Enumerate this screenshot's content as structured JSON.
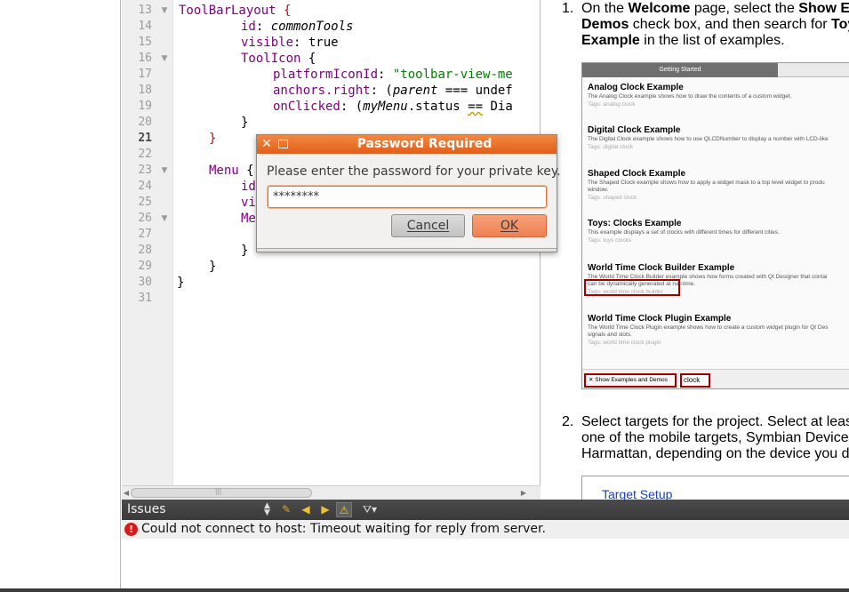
{
  "editor": {
    "lines": [
      {
        "num": "13",
        "fold": "▼"
      },
      {
        "num": "14",
        "fold": ""
      },
      {
        "num": "15",
        "fold": ""
      },
      {
        "num": "16",
        "fold": "▼"
      },
      {
        "num": "17",
        "fold": ""
      },
      {
        "num": "18",
        "fold": ""
      },
      {
        "num": "19",
        "fold": ""
      },
      {
        "num": "20",
        "fold": ""
      },
      {
        "num": "21",
        "fold": ""
      },
      {
        "num": "22",
        "fold": ""
      },
      {
        "num": "23",
        "fold": "▼"
      },
      {
        "num": "24",
        "fold": ""
      },
      {
        "num": "25",
        "fold": ""
      },
      {
        "num": "26",
        "fold": "▼"
      },
      {
        "num": "27",
        "fold": ""
      },
      {
        "num": "28",
        "fold": ""
      },
      {
        "num": "29",
        "fold": ""
      },
      {
        "num": "30",
        "fold": ""
      },
      {
        "num": "31",
        "fold": ""
      }
    ],
    "current_line": "21",
    "code": {
      "l13_type": "ToolBarLayout",
      "l13_brace": "{",
      "l14_key": "id",
      "l14_val": "commonTools",
      "l15_key": "visible",
      "l15_val": "true",
      "l16_type": "ToolIcon",
      "l16_brace": "{",
      "l17_key": "platformIconId",
      "l17_val": "\"toolbar-view-me",
      "l18_key": "anchors.right",
      "l18_val1": "parent",
      "l18_val2": " === undef",
      "l19_key": "onClicked",
      "l19_val1": "myMenu",
      "l19_val2": ".status ",
      "l19_op": "==",
      "l19_val3": " Dia",
      "l20": "}",
      "l21": "}",
      "l23_type": "Menu",
      "l23_brace": "{",
      "l24": "id",
      "l25": "vi",
      "l26": "Me",
      "l28": "}",
      "l29": "}",
      "l30": "}"
    }
  },
  "dialog": {
    "title": "Password Required",
    "prompt": "Please enter the password for your private key.",
    "password_value": "********",
    "cancel_label": "Cancel",
    "ok_label": "OK"
  },
  "help": {
    "step1_num": "1.",
    "step1_l1a": "On the ",
    "step1_l1b": "Welcome",
    "step1_l1c": " page, select the ",
    "step1_l1d": "Show E",
    "step1_l2a": "Demos",
    "step1_l2b": " check box, and then search for ",
    "step1_l2c": "Toy",
    "step1_l3a": "Example",
    "step1_l3b": " in the list of examples.",
    "welcome_tab": "Getting Started",
    "examples": [
      {
        "title": "Analog Clock Example",
        "desc": "The Analog Clock example shows how to draw the contents of a custom widget.",
        "tags": "Tags: analog clock"
      },
      {
        "title": "Digital Clock Example",
        "desc": "The Digital Clock example shows how to use QLCDNumber to display a number with LCD-like",
        "tags": "Tags: digital clock"
      },
      {
        "title": "Shaped Clock Example",
        "desc": "The Shaped Clock example shows how to apply a widget mask to a top level widget to produ",
        "desc2": "window.",
        "tags": "Tags: shaped clock"
      },
      {
        "title": "Toys: Clocks Example",
        "desc": "This example displays a set of clocks with different times for different cities.",
        "tags": "Tags: toys clocks"
      },
      {
        "title": "World Time Clock Builder Example",
        "desc": "The World Time Clock Builder example shows how forms created with Qt Designer that contai",
        "desc2": "can be dynamically generated at run-time.",
        "tags": "Tags: world time clock builder"
      },
      {
        "title": "World Time Clock Plugin Example",
        "desc": "The World Time Clock Plugin example shows how to create a custom widget plugin for Qt Des",
        "desc2": "signals and slots.",
        "tags": "Tags: world time clock plugin"
      }
    ],
    "show_examples_label": "Show Examples and Demos",
    "search_value": "clock",
    "step2_num": "2.",
    "step2_l1": "Select targets for the project. Select at leas",
    "step2_l2": "one of the mobile targets, Symbian Device,",
    "step2_l3": "Harmattan, depending on the device you d",
    "target_setup": "Target Setup"
  },
  "issues": {
    "title": "Issues",
    "message": "Could not connect to host: Timeout waiting for reply from server."
  },
  "icons": {
    "close": "close-icon",
    "error": "error-icon",
    "warning": "warning-icon",
    "filter": "filter-icon"
  },
  "colors": {
    "dialog_titlebar": "#e8702a",
    "keyword": "#800080",
    "string": "#008000",
    "error": "#d61b1b"
  }
}
